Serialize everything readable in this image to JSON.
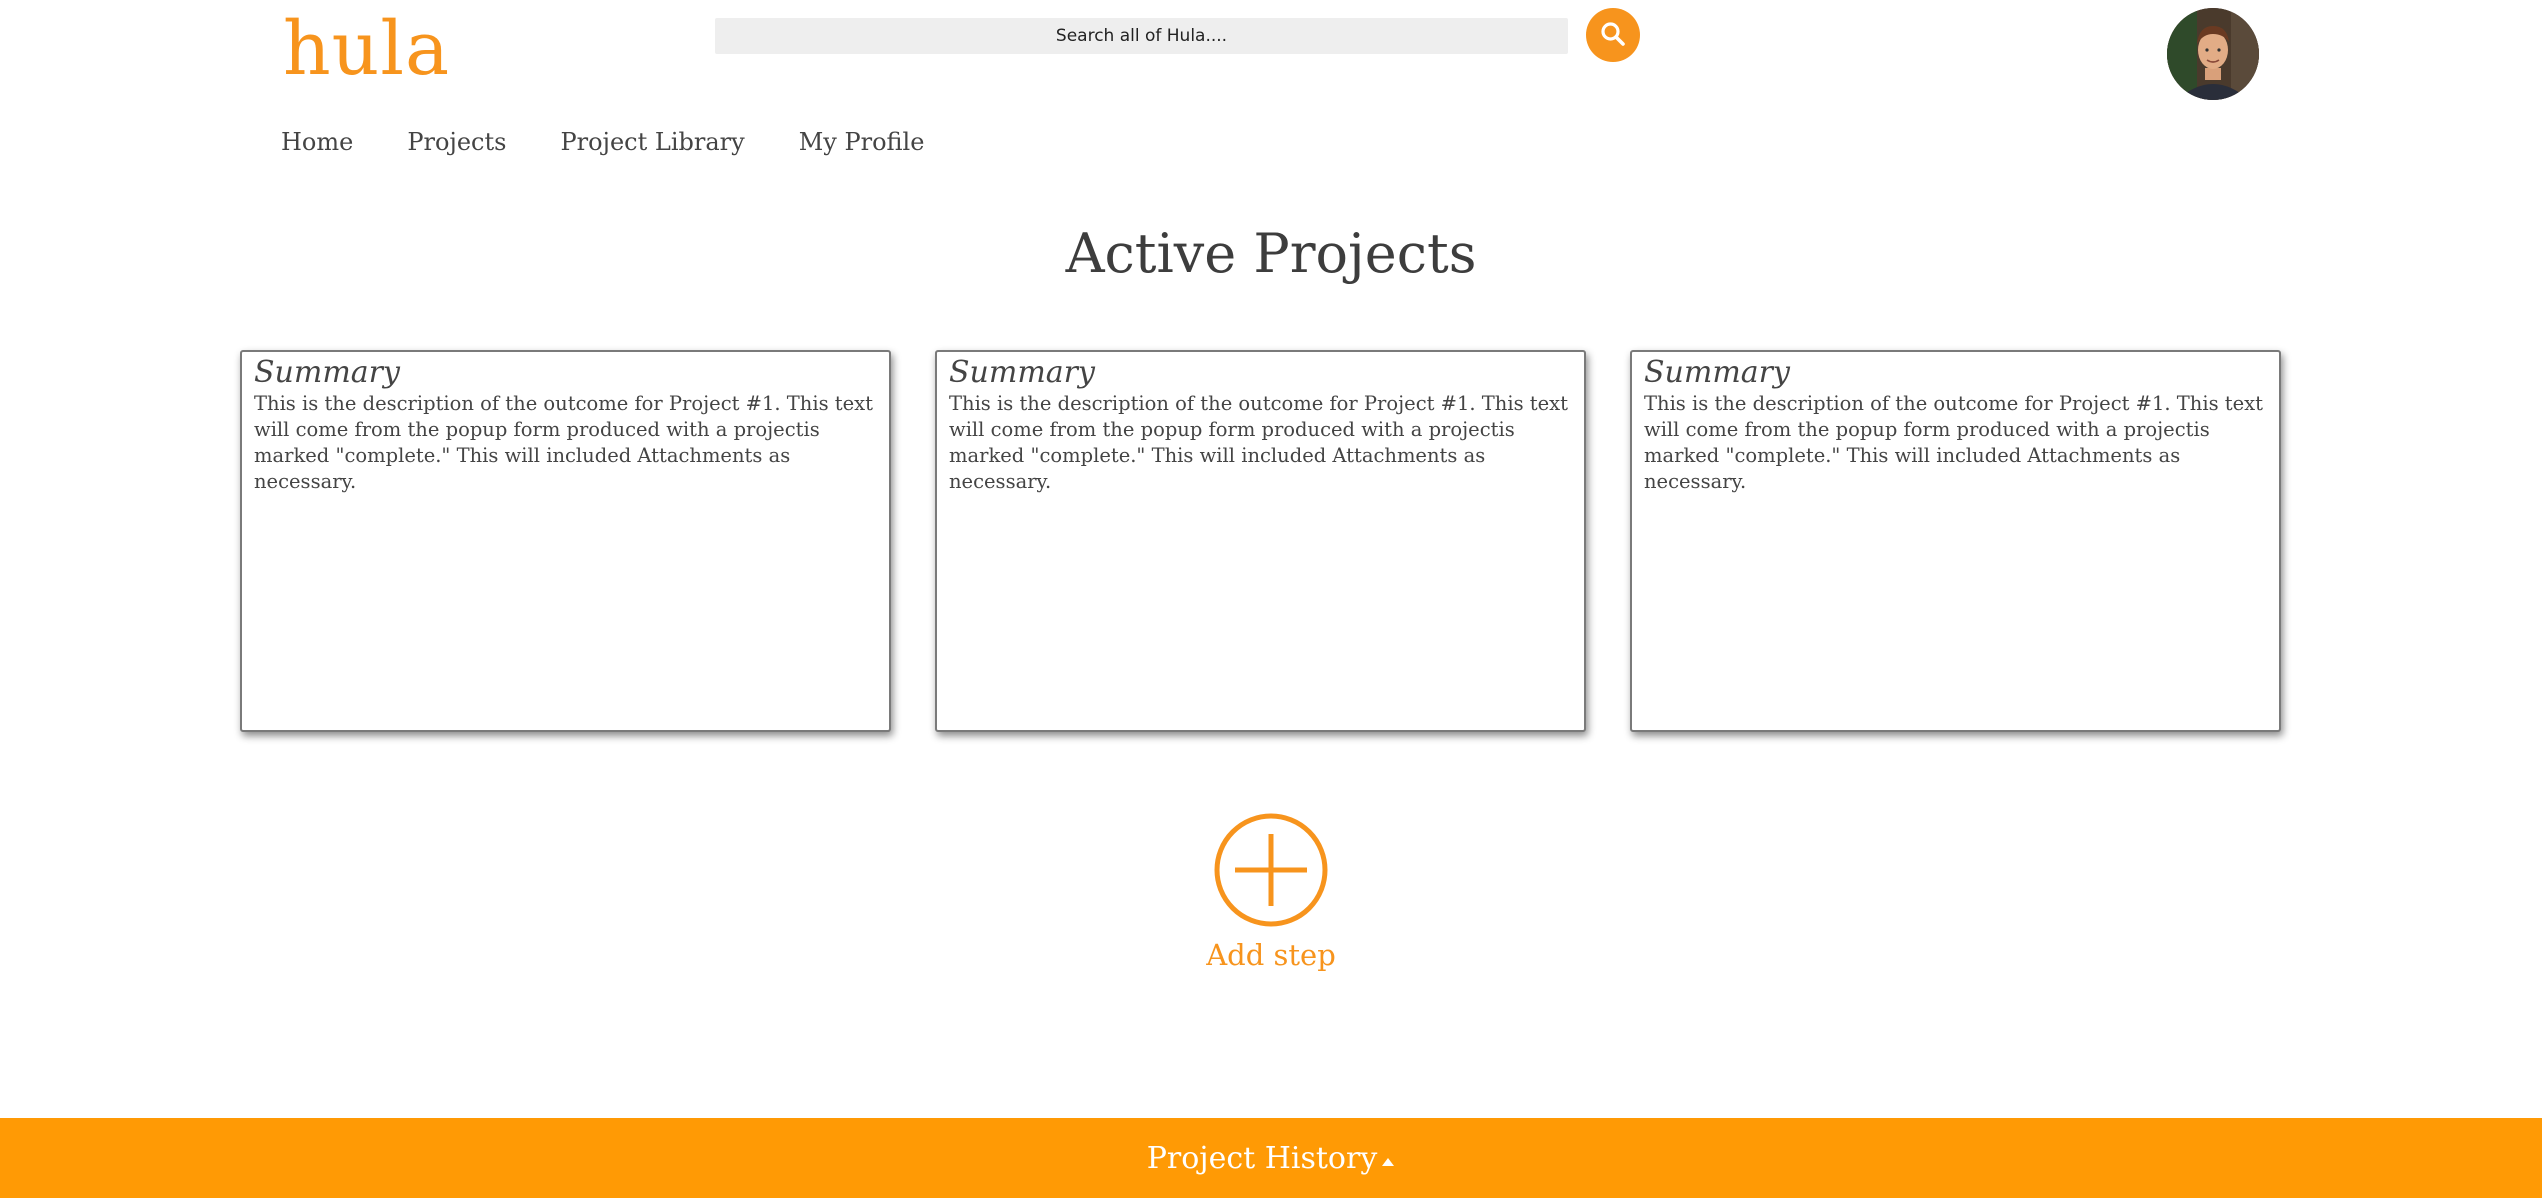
{
  "header": {
    "logo": "hula",
    "search": {
      "placeholder": "Search all of Hula...."
    },
    "search_button_icon": "search-icon",
    "avatar_icon": "user-avatar"
  },
  "nav": {
    "items": [
      {
        "label": "Home"
      },
      {
        "label": "Projects"
      },
      {
        "label": "Project Library"
      },
      {
        "label": "My Profile"
      }
    ]
  },
  "main": {
    "title": "Active Projects",
    "cards": [
      {
        "title": "Summary",
        "text": "This is the description of the outcome for Project #1. This text will come from the popup form produced with a projectis marked \"complete.\" This will included Attachments as necessary."
      },
      {
        "title": "Summary",
        "text": "This is the description of the outcome for Project #1. This text will come from the popup form produced with a projectis marked \"complete.\" This will included Attachments as necessary."
      },
      {
        "title": "Summary",
        "text": "This is the description of the outcome for Project #1. This text will come from the popup form produced with a projectis marked \"complete.\" This will included Attachments as necessary."
      }
    ],
    "add_step": {
      "label": "Add step",
      "icon": "plus-circle-icon"
    }
  },
  "footer": {
    "label": "Project History",
    "icon": "caret-up-icon"
  },
  "colors": {
    "accent": "#f7941d",
    "footer": "#ff9a05",
    "search_bg": "#eeeeee",
    "text": "#444444"
  }
}
